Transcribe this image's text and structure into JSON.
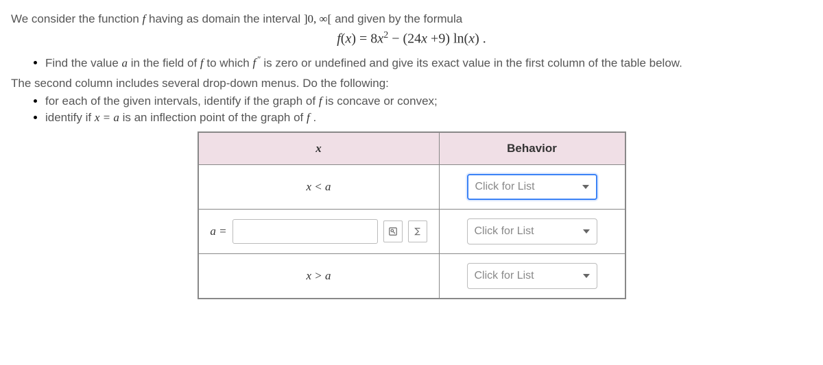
{
  "intro": {
    "pre": "We consider the function",
    "f": "f",
    "mid": "having as domain the interval",
    "interval": "]0, ∞[",
    "post": "and given by the formula"
  },
  "formula": "f(x) = 8x² − (24x +9) ln(x) .",
  "bullet1": {
    "pre": "Find the value",
    "a": "a",
    "mid1": "in the field of",
    "f": "f",
    "mid2": "to which",
    "fpp": "f″",
    "post": "is zero or undefined and give its exact value in the first column of the table below."
  },
  "para2": "The second column includes several drop-down menus. Do the following:",
  "bullet2": {
    "pre": "for each of the given intervals, identify if the graph of",
    "f": "f",
    "post": "is concave or convex;"
  },
  "bullet3": {
    "pre": "identify if",
    "xa": "x = a",
    "mid": "is an inflection point of the graph of",
    "f": "f",
    "post": "."
  },
  "table": {
    "header_x": "x",
    "header_b": "Behavior",
    "row1_x": "x < a",
    "row2_label": "a =",
    "row3_x": "x > a",
    "dropdown_placeholder": "Click for List"
  }
}
